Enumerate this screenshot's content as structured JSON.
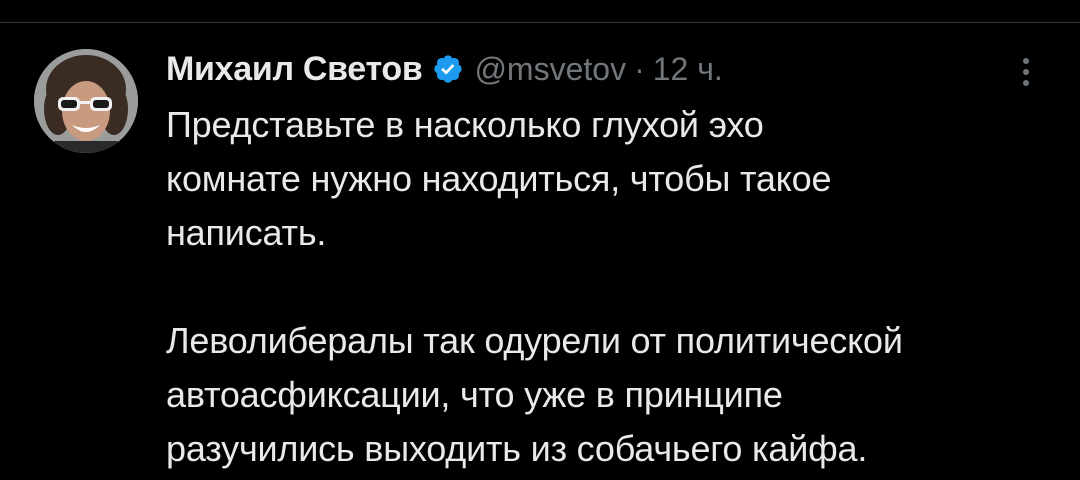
{
  "tweet": {
    "author": {
      "display_name": "Михаил Светов",
      "handle": "@msvetov",
      "verified": true,
      "avatar_icon": "profile-photo-avatar"
    },
    "separator": "·",
    "time": "12 ч.",
    "more_icon": "more-vertical-icon",
    "paragraphs": [
      "Представьте в насколько глухой эхо\nкомнате нужно находиться, чтобы такое\nнаписать.",
      "Леволибералы так одурели от политической\nавтоасфиксации, что уже в принципе\nразучились выходить из собачьего кайфа."
    ]
  },
  "colors": {
    "background": "#000000",
    "primary_text": "#e7e9ea",
    "secondary_text": "#71767b",
    "verified_badge": "#1d9bf0",
    "divider": "#2f3336"
  }
}
